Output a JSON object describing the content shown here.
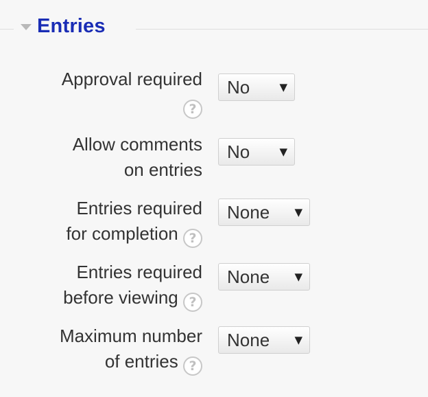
{
  "section": {
    "title": "Entries",
    "collapse_icon": "chevron-down-icon"
  },
  "fields": [
    {
      "label_lines": [
        "Approval required",
        ""
      ],
      "has_help": true,
      "help_glyph": "?",
      "value": "No",
      "caret": "▼"
    },
    {
      "label_lines": [
        "Allow comments",
        "on entries"
      ],
      "has_help": false,
      "value": "No",
      "caret": "▼"
    },
    {
      "label_lines": [
        "Entries required",
        "for completion"
      ],
      "has_help": true,
      "help_glyph": "?",
      "value": "None",
      "caret": "▼"
    },
    {
      "label_lines": [
        "Entries required",
        "before viewing"
      ],
      "has_help": true,
      "help_glyph": "?",
      "value": "None",
      "caret": "▼"
    },
    {
      "label_lines": [
        "Maximum number",
        "of entries"
      ],
      "has_help": true,
      "help_glyph": "?",
      "value": "None",
      "caret": "▼"
    }
  ],
  "colors": {
    "legend": "#1a2db5",
    "text": "#333333",
    "background": "#f7f7f7"
  }
}
